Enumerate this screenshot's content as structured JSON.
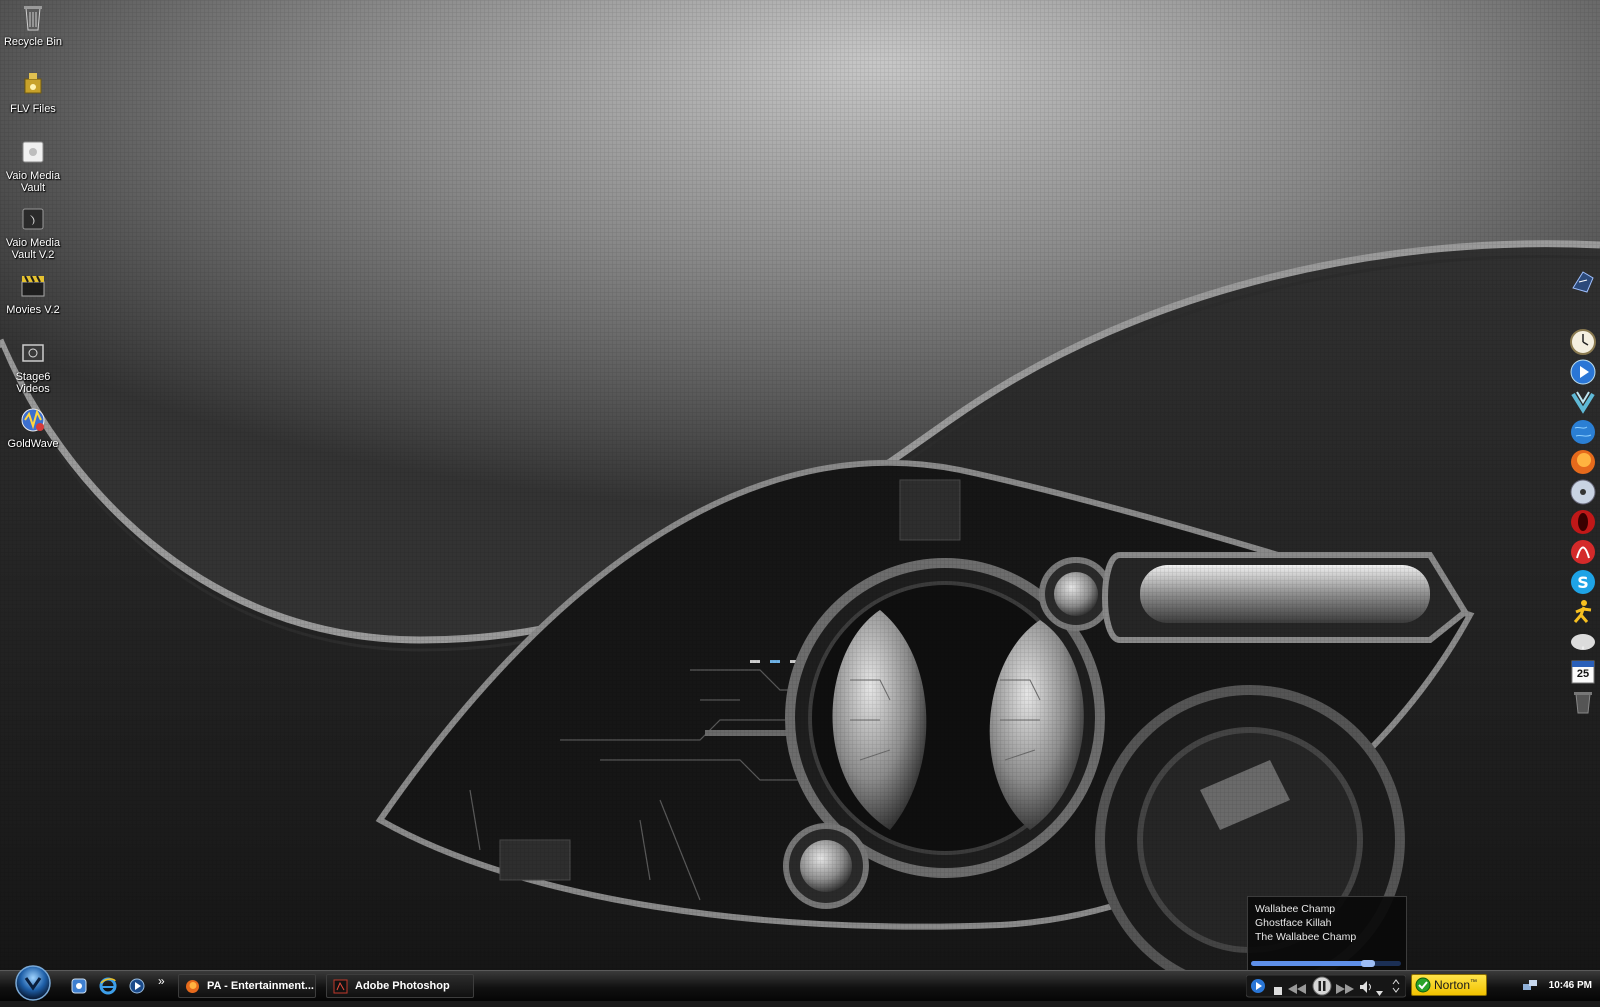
{
  "desktop": {
    "icons": [
      {
        "label": "Recycle Bin",
        "icon": "recycle-bin-icon"
      },
      {
        "label": "FLV Files",
        "icon": "folder-icon"
      },
      {
        "label": "Vaio Media Vault",
        "icon": "media-vault-icon"
      },
      {
        "label": "Vaio Media Vault V.2",
        "icon": "media-vault-v2-icon"
      },
      {
        "label": "Movies V.2",
        "icon": "clapperboard-icon"
      },
      {
        "label": "Stage6 Videos",
        "icon": "stage6-icon"
      },
      {
        "label": "GoldWave",
        "icon": "goldwave-icon"
      }
    ]
  },
  "dock": {
    "calendar_day": "25",
    "items": [
      "winamp-icon",
      "clock-icon",
      "media-player-icon",
      "downloads-icon",
      "globe-icon",
      "firefox-icon",
      "cd-icon",
      "opera-icon",
      "acrobat-icon",
      "skype-icon",
      "aim-icon",
      "weather-icon",
      "calendar-icon",
      "trash-icon"
    ]
  },
  "media_popup": {
    "song": "Wallabee Champ",
    "artist": "Ghostface Killah",
    "album": "The Wallabee Champ",
    "progress": 0.78
  },
  "taskbar": {
    "quick_launch": [
      "show-desktop-icon",
      "internet-explorer-icon",
      "media-player-icon"
    ],
    "overflow": "»",
    "buttons": [
      {
        "label": "PA - Entertainment...",
        "icon": "firefox-icon"
      },
      {
        "label": "Adobe Photoshop",
        "icon": "photoshop-icon"
      }
    ],
    "norton_label": "Norton",
    "norton_tm": "™",
    "clock": "10:46 PM"
  },
  "colors": {
    "accent": "#5e8fe8",
    "norton": "#f1c200",
    "taskbar": "#111111"
  }
}
